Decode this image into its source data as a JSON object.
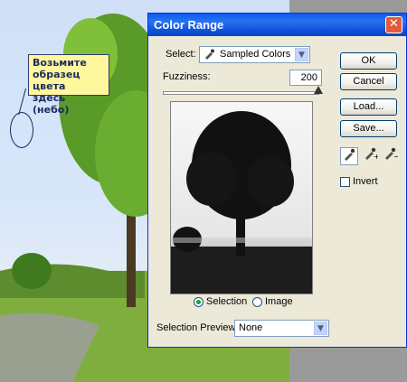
{
  "note": {
    "line1": "Возьмите",
    "line2": "образец цвета",
    "line3": "здесь (небо)"
  },
  "dialog": {
    "title": "Color Range",
    "close_glyph": "✕",
    "select_label": "Select:",
    "select_value": "Sampled Colors",
    "fuzziness_label": "Fuzziness:",
    "fuzziness_value": "200",
    "radio_selection": "Selection",
    "radio_image": "Image",
    "selected_radio": "Selection",
    "buttons": {
      "ok": "OK",
      "cancel": "Cancel",
      "load": "Load...",
      "save": "Save..."
    },
    "invert_label": "Invert",
    "invert_checked": false,
    "preview_label": "Selection Preview:",
    "preview_value": "None"
  },
  "icons": {
    "eyedropper": "eyedropper-icon",
    "eyedropper_plus": "eyedropper-plus-icon",
    "eyedropper_minus": "eyedropper-minus-icon"
  }
}
